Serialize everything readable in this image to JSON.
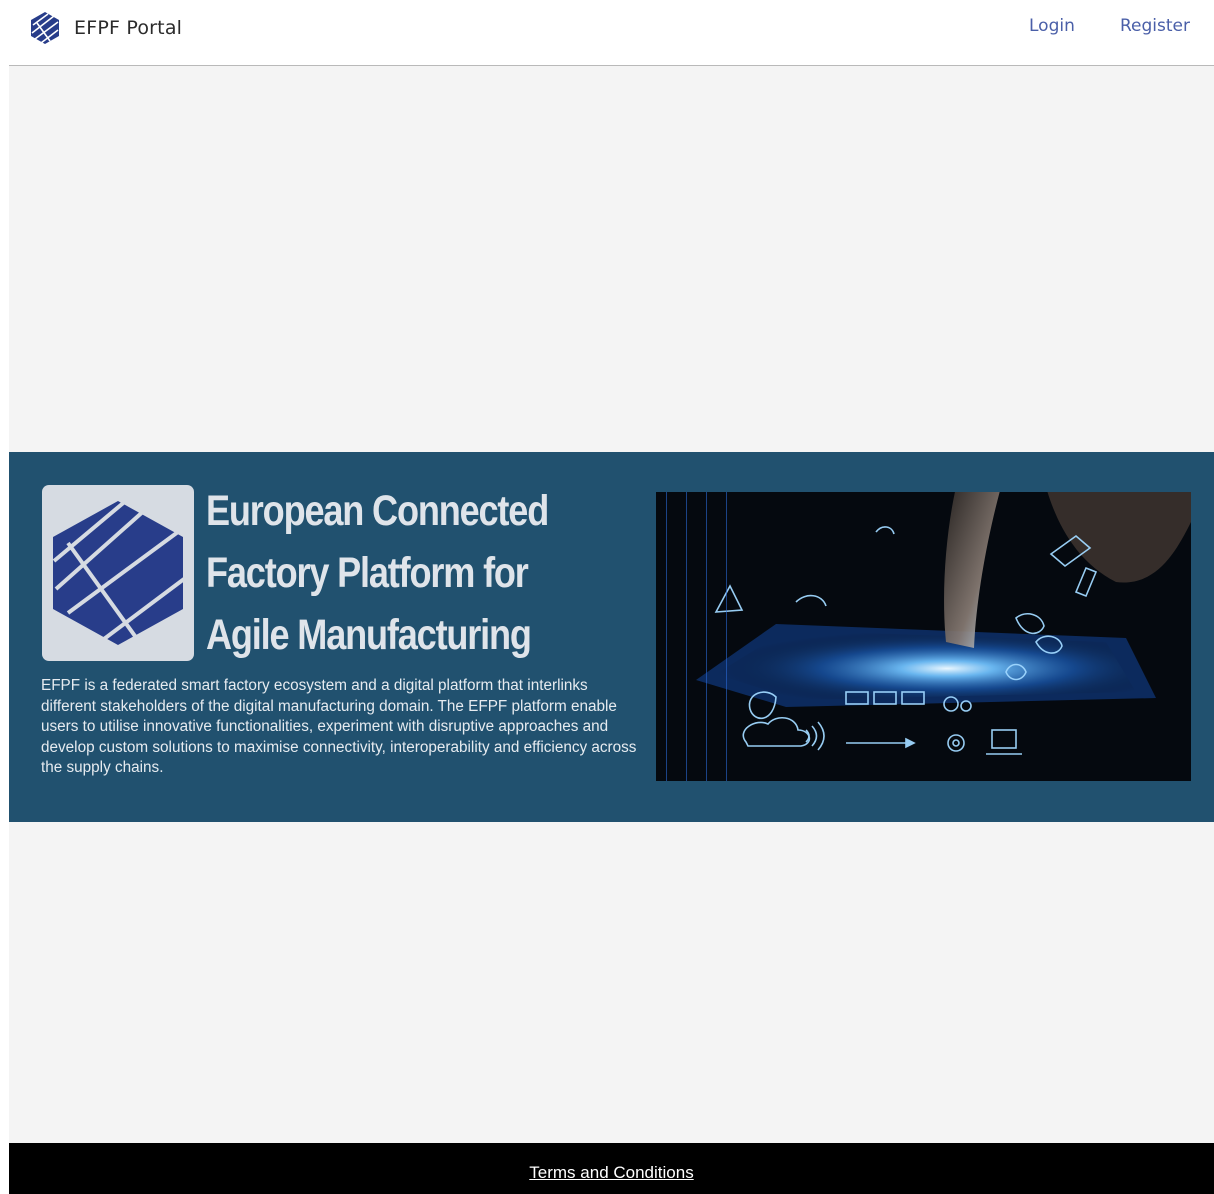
{
  "navbar": {
    "brand_text": "EFPF Portal",
    "brand_icon": "efpf-hexagon-logo-icon",
    "links": {
      "login": "Login",
      "register": "Register"
    }
  },
  "hero": {
    "title": "European Connected Factory Platform for Agile Manufacturing",
    "description": "EFPF is a federated smart factory ecosystem and a digital platform that interlinks different stakeholders of the digital manufacturing domain. The EFPF platform enable users to utilise innovative functionalities, experiment with disruptive approaches and develop custom solutions to maximise connectivity, interoperability and efficiency across the supply chains.",
    "logo_icon": "efpf-hexagon-logo-icon",
    "image_icon": "digital-tablet-network-illustration"
  },
  "footer": {
    "terms_label": "Terms and Conditions"
  },
  "colors": {
    "hero_background": "#21516f",
    "logo_blue": "#283d8a",
    "link_blue": "#4a5fa8",
    "page_background": "#f4f4f4",
    "footer_background": "#000000"
  }
}
